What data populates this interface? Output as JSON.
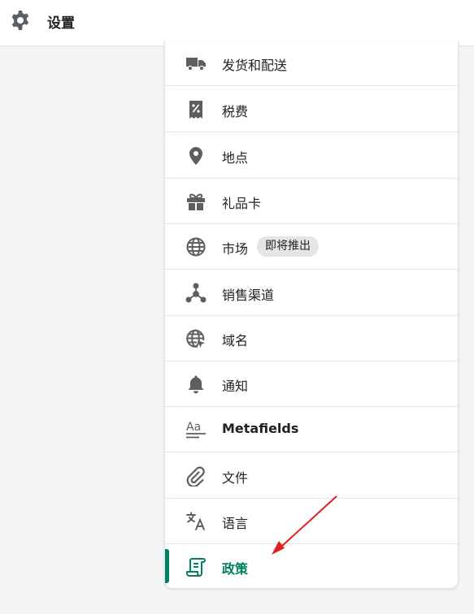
{
  "header": {
    "title": "设置",
    "icon": "gear-icon"
  },
  "menu": {
    "items": [
      {
        "label": "发货和配送",
        "icon": "truck-icon"
      },
      {
        "label": "税费",
        "icon": "receipt-percent-icon"
      },
      {
        "label": "地点",
        "icon": "location-pin-icon"
      },
      {
        "label": "礼品卡",
        "icon": "gift-icon"
      },
      {
        "label": "市场",
        "icon": "globe-icon",
        "badge": "即将推出"
      },
      {
        "label": "销售渠道",
        "icon": "channels-icon"
      },
      {
        "label": "域名",
        "icon": "domain-globe-icon"
      },
      {
        "label": "通知",
        "icon": "bell-icon"
      },
      {
        "label": "Metafields",
        "icon": "metafields-icon"
      },
      {
        "label": "文件",
        "icon": "paperclip-icon"
      },
      {
        "label": "语言",
        "icon": "translate-icon"
      },
      {
        "label": "政策",
        "icon": "policy-scroll-icon",
        "active": true
      }
    ]
  },
  "colors": {
    "accent": "#008060",
    "icon": "#5c5f62",
    "annotation_arrow": "#e02020",
    "badge_bg": "#e4e5e7"
  }
}
